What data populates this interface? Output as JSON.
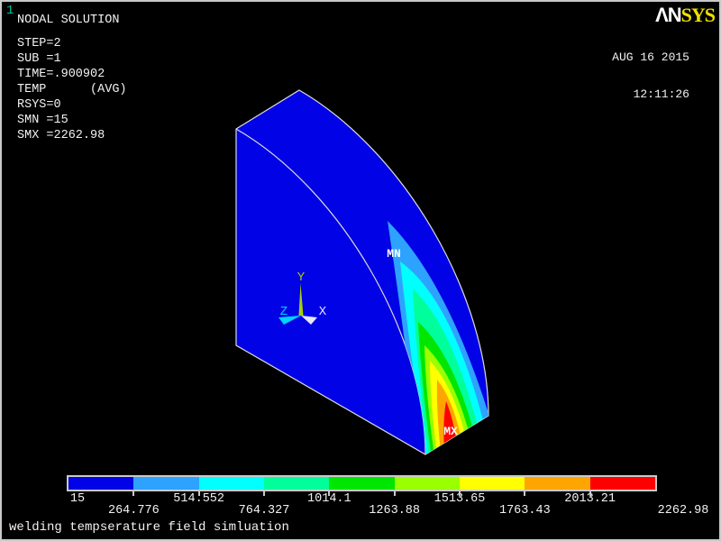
{
  "window": {
    "plot_number": "1",
    "background": "#000000",
    "border_color": "#C9C9C9"
  },
  "header": {
    "logo_an": "ΛN",
    "logo_sys": "SYS",
    "date": "AUG 16 2015",
    "time": "12:11:26"
  },
  "info": {
    "title": "NODAL SOLUTION",
    "lines": [
      "STEP=2",
      "SUB =1",
      "TIME=.900902",
      "TEMP      (AVG)",
      "RSYS=0",
      "SMN =15",
      "SMX =2262.98"
    ]
  },
  "model": {
    "body_color": "#0202E6",
    "edge_color": "#DCDCDC",
    "min_label": "MN",
    "max_label": "MX",
    "triad": {
      "x_label": "X",
      "y_label": "Y",
      "z_label": "Z",
      "x_color": "#E6E6FF",
      "y_color": "#A6D100",
      "z_color": "#00D2FF"
    }
  },
  "legend": {
    "colors": [
      "#0202E6",
      "#2EA2FF",
      "#00FFFF",
      "#00FF9A",
      "#00E600",
      "#9AFF00",
      "#FFFF00",
      "#FFA500",
      "#FF0000"
    ],
    "labels": [
      "15",
      "264.776",
      "514.552",
      "764.327",
      "1014.1",
      "1263.88",
      "1513.65",
      "1763.43",
      "2013.21",
      "2262.98"
    ],
    "min": 15,
    "max": 2262.98
  },
  "caption": "welding tempserature field simluation"
}
